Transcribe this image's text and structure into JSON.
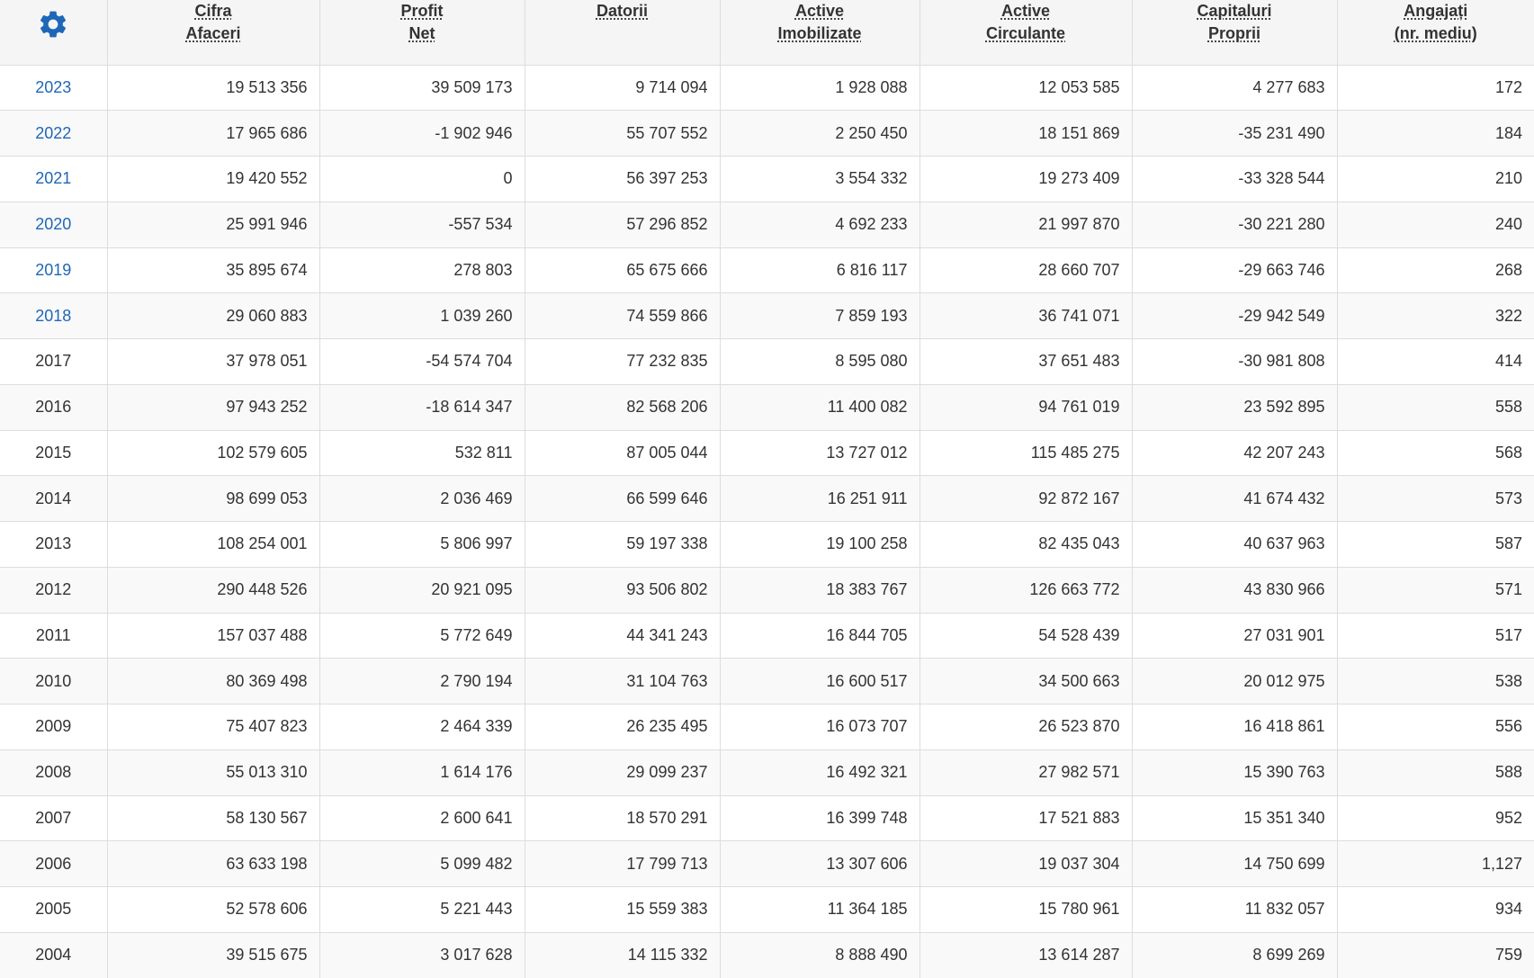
{
  "header": {
    "settings_icon": "gear-icon",
    "columns": [
      {
        "line1": "Cifra",
        "line2": "Afaceri"
      },
      {
        "line1": "Profit",
        "line2": "Net"
      },
      {
        "line1": "Datorii",
        "line2": ""
      },
      {
        "line1": "Active",
        "line2": "Imobilizate"
      },
      {
        "line1": "Active",
        "line2": "Circulante"
      },
      {
        "line1": "Capitaluri",
        "line2": "Proprii"
      },
      {
        "line1": "Angajați",
        "line2": "(nr. mediu)"
      }
    ]
  },
  "colors": {
    "link": "#1e67b8",
    "gear": "#1e67b8",
    "header_bg": "#f5f5f5",
    "stripe_bg": "#f9f9f9",
    "border": "#dddddd"
  },
  "rows": [
    {
      "year": "2023",
      "link": true,
      "values": [
        "19 513 356",
        "39 509 173",
        "9 714 094",
        "1 928 088",
        "12 053 585",
        "4 277 683",
        "172"
      ]
    },
    {
      "year": "2022",
      "link": true,
      "values": [
        "17 965 686",
        "-1 902 946",
        "55 707 552",
        "2 250 450",
        "18 151 869",
        "-35 231 490",
        "184"
      ]
    },
    {
      "year": "2021",
      "link": true,
      "values": [
        "19 420 552",
        "0",
        "56 397 253",
        "3 554 332",
        "19 273 409",
        "-33 328 544",
        "210"
      ]
    },
    {
      "year": "2020",
      "link": true,
      "values": [
        "25 991 946",
        "-557 534",
        "57 296 852",
        "4 692 233",
        "21 997 870",
        "-30 221 280",
        "240"
      ]
    },
    {
      "year": "2019",
      "link": true,
      "values": [
        "35 895 674",
        "278 803",
        "65 675 666",
        "6 816 117",
        "28 660 707",
        "-29 663 746",
        "268"
      ]
    },
    {
      "year": "2018",
      "link": true,
      "values": [
        "29 060 883",
        "1 039 260",
        "74 559 866",
        "7 859 193",
        "36 741 071",
        "-29 942 549",
        "322"
      ]
    },
    {
      "year": "2017",
      "link": false,
      "values": [
        "37 978 051",
        "-54 574 704",
        "77 232 835",
        "8 595 080",
        "37 651 483",
        "-30 981 808",
        "414"
      ]
    },
    {
      "year": "2016",
      "link": false,
      "values": [
        "97 943 252",
        "-18 614 347",
        "82 568 206",
        "11 400 082",
        "94 761 019",
        "23 592 895",
        "558"
      ]
    },
    {
      "year": "2015",
      "link": false,
      "values": [
        "102 579 605",
        "532 811",
        "87 005 044",
        "13 727 012",
        "115 485 275",
        "42 207 243",
        "568"
      ]
    },
    {
      "year": "2014",
      "link": false,
      "values": [
        "98 699 053",
        "2 036 469",
        "66 599 646",
        "16 251 911",
        "92 872 167",
        "41 674 432",
        "573"
      ]
    },
    {
      "year": "2013",
      "link": false,
      "values": [
        "108 254 001",
        "5 806 997",
        "59 197 338",
        "19 100 258",
        "82 435 043",
        "40 637 963",
        "587"
      ]
    },
    {
      "year": "2012",
      "link": false,
      "values": [
        "290 448 526",
        "20 921 095",
        "93 506 802",
        "18 383 767",
        "126 663 772",
        "43 830 966",
        "571"
      ]
    },
    {
      "year": "2011",
      "link": false,
      "values": [
        "157 037 488",
        "5 772 649",
        "44 341 243",
        "16 844 705",
        "54 528 439",
        "27 031 901",
        "517"
      ]
    },
    {
      "year": "2010",
      "link": false,
      "values": [
        "80 369 498",
        "2 790 194",
        "31 104 763",
        "16 600 517",
        "34 500 663",
        "20 012 975",
        "538"
      ]
    },
    {
      "year": "2009",
      "link": false,
      "values": [
        "75 407 823",
        "2 464 339",
        "26 235 495",
        "16 073 707",
        "26 523 870",
        "16 418 861",
        "556"
      ]
    },
    {
      "year": "2008",
      "link": false,
      "values": [
        "55 013 310",
        "1 614 176",
        "29 099 237",
        "16 492 321",
        "27 982 571",
        "15 390 763",
        "588"
      ]
    },
    {
      "year": "2007",
      "link": false,
      "values": [
        "58 130 567",
        "2 600 641",
        "18 570 291",
        "16 399 748",
        "17 521 883",
        "15 351 340",
        "952"
      ]
    },
    {
      "year": "2006",
      "link": false,
      "values": [
        "63 633 198",
        "5 099 482",
        "17 799 713",
        "13 307 606",
        "19 037 304",
        "14 750 699",
        "1,127"
      ]
    },
    {
      "year": "2005",
      "link": false,
      "values": [
        "52 578 606",
        "5 221 443",
        "15 559 383",
        "11 364 185",
        "15 780 961",
        "11 832 057",
        "934"
      ]
    },
    {
      "year": "2004",
      "link": false,
      "values": [
        "39 515 675",
        "3 017 628",
        "14 115 332",
        "8 888 490",
        "13 614 287",
        "8 699 269",
        "759"
      ]
    }
  ]
}
